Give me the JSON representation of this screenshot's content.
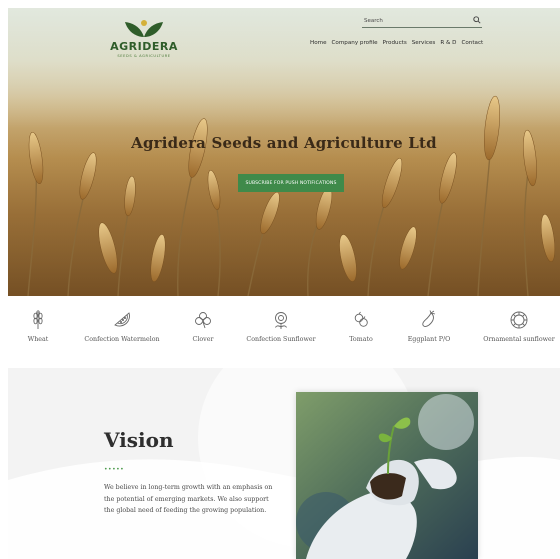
{
  "brand": {
    "name": "AGRIDERA",
    "tagline": "SEEDS & AGRICULTURE",
    "primary_color": "#3f8a4a",
    "logo_dark_green": "#2f5d2a",
    "logo_accent": "#d4b13a"
  },
  "header": {
    "search_placeholder": "Search",
    "nav": [
      "Home",
      "Company profile",
      "Products",
      "Services",
      "R & D",
      "Contact"
    ]
  },
  "hero": {
    "title": "Agridera Seeds and Agriculture Ltd",
    "cta_label": "SUBSCRIBE FOR PUSH NOTIFICATIONS"
  },
  "products": [
    {
      "label": "Wheat",
      "icon": "wheat-icon"
    },
    {
      "label": "Confection Watermelon",
      "icon": "watermelon-icon"
    },
    {
      "label": "Clover",
      "icon": "clover-icon"
    },
    {
      "label": "Confection Sunflower",
      "icon": "sunflower-icon"
    },
    {
      "label": "Tomato",
      "icon": "tomato-icon"
    },
    {
      "label": "Eggplant P/O",
      "icon": "eggplant-icon"
    },
    {
      "label": "Ornamental sunflower",
      "icon": "ornamental-sunflower-icon"
    }
  ],
  "vision": {
    "title": "Vision",
    "divider": "•••••",
    "text": "We believe in long-term growth with an emphasis on the potential of emerging markets. We also support the global need of feeding the growing population."
  }
}
